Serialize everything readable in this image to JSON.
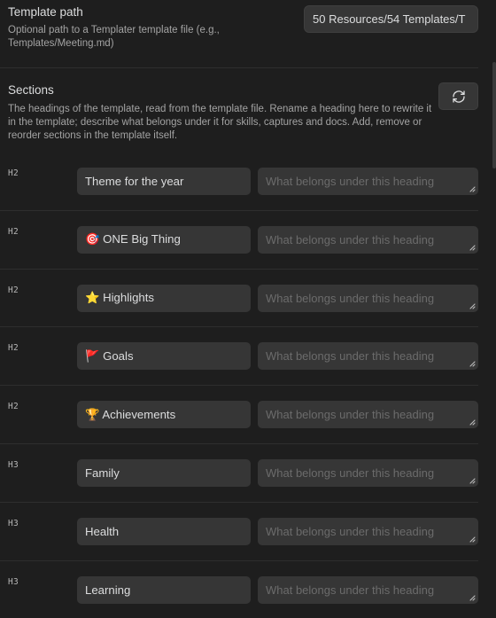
{
  "template_path": {
    "label": "Template path",
    "description": "Optional path to a Templater template file (e.g., Templates/Meeting.md)",
    "value": "50 Resources/54 Templates/T"
  },
  "sections": {
    "label": "Sections",
    "description": "The headings of the template, read from the template file. Rename a heading here to rewrite it in the template; describe what belongs under it for skills, captures and docs. Add, remove or reorder sections in the template itself.",
    "refresh_icon": "refresh-icon",
    "description_placeholder": "What belongs under this heading",
    "rows": [
      {
        "level": "H2",
        "heading": "Theme for the year"
      },
      {
        "level": "H2",
        "heading": "🎯 ONE Big Thing"
      },
      {
        "level": "H2",
        "heading": "⭐ Highlights"
      },
      {
        "level": "H2",
        "heading": "🚩 Goals"
      },
      {
        "level": "H2",
        "heading": "🏆 Achievements"
      },
      {
        "level": "H3",
        "heading": "Family"
      },
      {
        "level": "H3",
        "heading": "Health"
      },
      {
        "level": "H3",
        "heading": "Learning"
      }
    ]
  }
}
